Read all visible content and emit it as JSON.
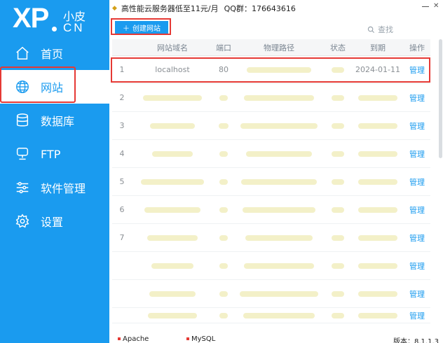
{
  "logo": {
    "brand": "XP",
    "cn_top": "小皮",
    "cn_bottom": "CN"
  },
  "sidebar": {
    "items": [
      {
        "label": "首页",
        "icon": "home-icon"
      },
      {
        "label": "网站",
        "icon": "globe-icon",
        "active": true
      },
      {
        "label": "数据库",
        "icon": "database-icon"
      },
      {
        "label": "FTP",
        "icon": "server-icon"
      },
      {
        "label": "软件管理",
        "icon": "sliders-icon"
      },
      {
        "label": "设置",
        "icon": "gear-icon"
      }
    ]
  },
  "topbar": {
    "ad": "高性能云服务器低至11元/月",
    "qq": "QQ群：176643616"
  },
  "toolbar": {
    "create_label": "创建网站",
    "search_placeholder": "查找"
  },
  "table": {
    "headers": [
      "",
      "网站域名",
      "端口",
      "物理路径",
      "状态",
      "到期",
      "操作"
    ],
    "rows": [
      {
        "idx": "1",
        "name": "localhost",
        "port": "80",
        "path": "",
        "status": "",
        "expire": "2024-01-11",
        "op": "管理"
      },
      {
        "idx": "2",
        "name": "",
        "port": "",
        "path": "",
        "status": "",
        "expire": "",
        "op": "管理"
      },
      {
        "idx": "3",
        "name": "",
        "port": "",
        "path": "",
        "status": "",
        "expire": "",
        "op": "管理"
      },
      {
        "idx": "4",
        "name": "",
        "port": "",
        "path": "",
        "status": "",
        "expire": "",
        "op": "管理"
      },
      {
        "idx": "5",
        "name": "",
        "port": "",
        "path": "",
        "status": "",
        "expire": "",
        "op": "管理"
      },
      {
        "idx": "6",
        "name": "",
        "port": "",
        "path": "",
        "status": "",
        "expire": "",
        "op": "管理"
      },
      {
        "idx": "7",
        "name": "",
        "port": "",
        "path": "",
        "status": "",
        "expire": "",
        "op": "管理"
      },
      {
        "idx": "",
        "name": "",
        "port": "",
        "path": "",
        "status": "",
        "expire": "",
        "op": "管理"
      },
      {
        "idx": "",
        "name": "",
        "port": "",
        "path": "",
        "status": "",
        "expire": "",
        "op": "管理"
      },
      {
        "idx": "",
        "name": "",
        "port": "",
        "path": "",
        "status": "",
        "expire": "",
        "op": "管理"
      }
    ]
  },
  "statusbar": {
    "service1": "Apache",
    "service2": "MySQL",
    "version": "版本：8.1.1.3"
  },
  "colors": {
    "accent": "#1a9bef",
    "highlight": "#e53935"
  }
}
